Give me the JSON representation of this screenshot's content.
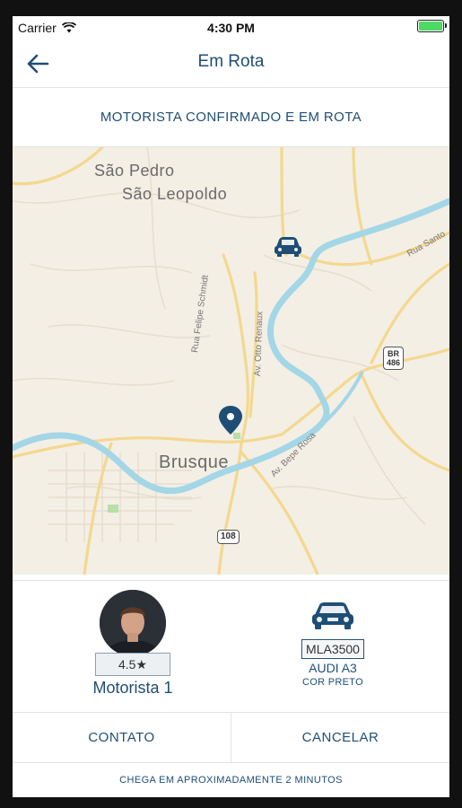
{
  "status_bar": {
    "carrier": "Carrier",
    "time": "4:30 PM"
  },
  "nav": {
    "title": "Em Rota",
    "back_icon": "arrow-left-icon"
  },
  "banner": {
    "text": "MOTORISTA CONFIRMADO E EM ROTA"
  },
  "map": {
    "labels": {
      "sao_pedro": "São Pedro",
      "sao_leopoldo": "São Leopoldo",
      "brusque": "Brusque",
      "rua_felipe_schmidt": "Rua Felipe Schmidt",
      "av_otto_renaux": "Av. Otto Renaux",
      "av_bepe_rosa": "Av. Bepe Rosa",
      "rua_santos": "Rua Santo"
    },
    "shields": {
      "br486_top": "BR",
      "br486_bottom": "486",
      "r108": "108"
    },
    "colors": {
      "land": "#f4efe4",
      "river": "#a3d6e6",
      "road": "#f6d78a",
      "marker": "#1f4e75"
    }
  },
  "driver": {
    "rating": "4.5★",
    "name": "Motorista 1"
  },
  "car": {
    "plate": "MLA3500",
    "model": "AUDI A3",
    "color": "COR PRETO"
  },
  "actions": {
    "contact": "CONTATO",
    "cancel": "CANCELAR"
  },
  "eta": {
    "text": "CHEGA EM APROXIMADAMENTE 2 MINUTOS"
  }
}
